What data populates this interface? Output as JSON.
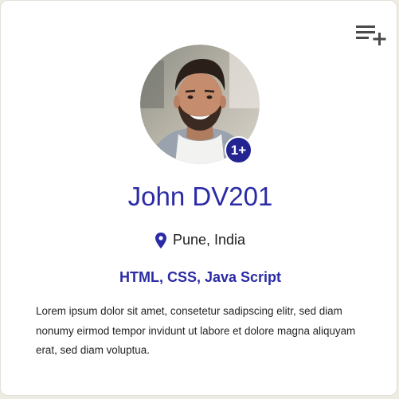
{
  "profile": {
    "name": "John DV201",
    "badge": "1+",
    "location": "Pune, India",
    "skills": "HTML, CSS, Java Script",
    "bio": "Lorem ipsum dolor sit amet, consetetur sadipscing elitr, sed diam nonumy eirmod tempor invidunt ut labore et dolore magna aliquyam erat, sed diam voluptua."
  },
  "icons": {
    "top_right": "playlist-add-icon",
    "location": "location-pin-icon"
  },
  "colors": {
    "accent": "#2b2ba6",
    "badge_bg": "#232392",
    "icon_gray": "#4a4a4a",
    "card_bg": "#ffffff",
    "page_bg": "#eeebe3"
  }
}
